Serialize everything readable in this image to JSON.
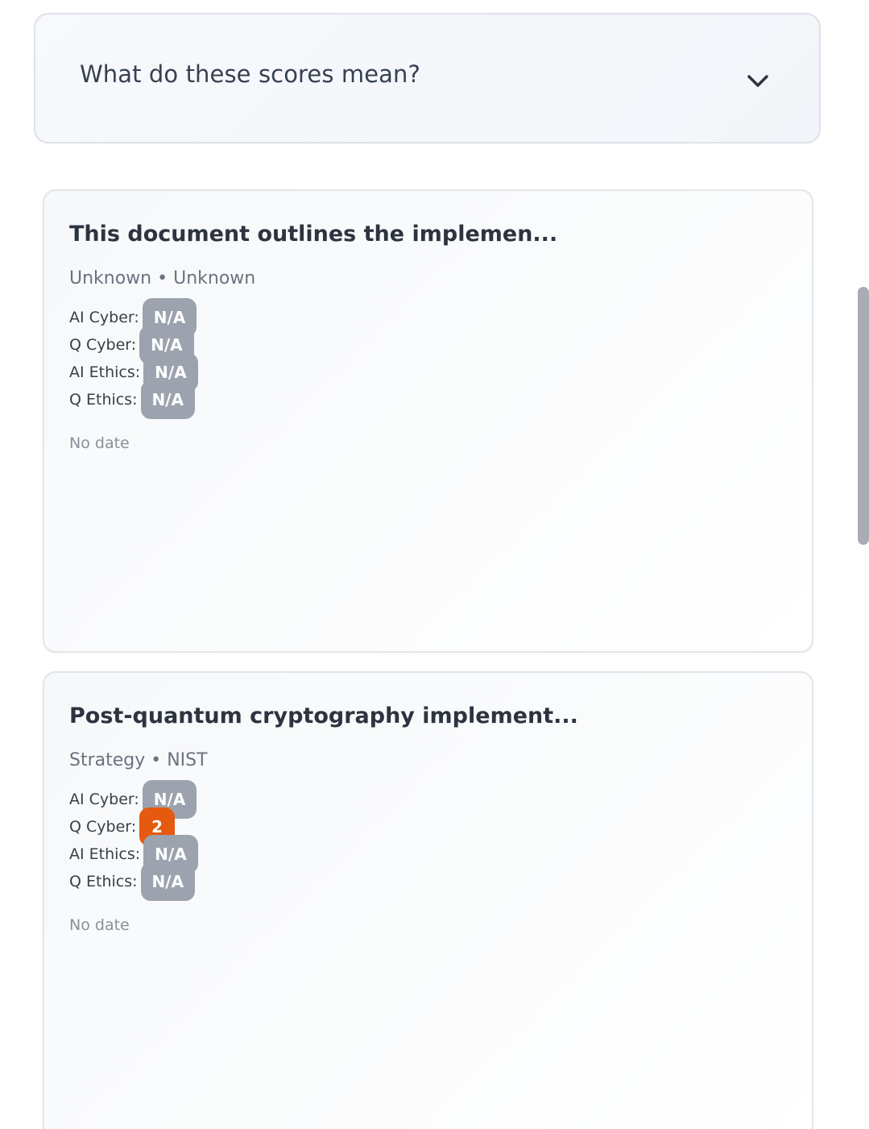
{
  "accordion": {
    "title": "What do these scores mean?",
    "icon": "chevron-down-icon"
  },
  "cards": [
    {
      "title": "This document outlines the implemen...",
      "meta": "Unknown • Unknown",
      "scores": [
        {
          "label": "AI Cyber:",
          "value": "N/A"
        },
        {
          "label": "Q Cyber:",
          "value": "N/A"
        },
        {
          "label": "AI Ethics:",
          "value": "N/A"
        },
        {
          "label": "Q Ethics:",
          "value": "N/A"
        }
      ],
      "date": "No date"
    },
    {
      "title": "Post-quantum cryptography implement...",
      "meta": "Strategy • NIST",
      "scores": [
        {
          "label": "AI Cyber:",
          "value": "N/A"
        },
        {
          "label": "Q Cyber:",
          "value": "2"
        },
        {
          "label": "AI Ethics:",
          "value": "N/A"
        },
        {
          "label": "Q Ethics:",
          "value": "N/A"
        }
      ],
      "date": "No date"
    }
  ],
  "colors": {
    "badge_na": "#9ca3ae",
    "badge_score": "#e55a0f",
    "text_dark": "#2d3440"
  }
}
